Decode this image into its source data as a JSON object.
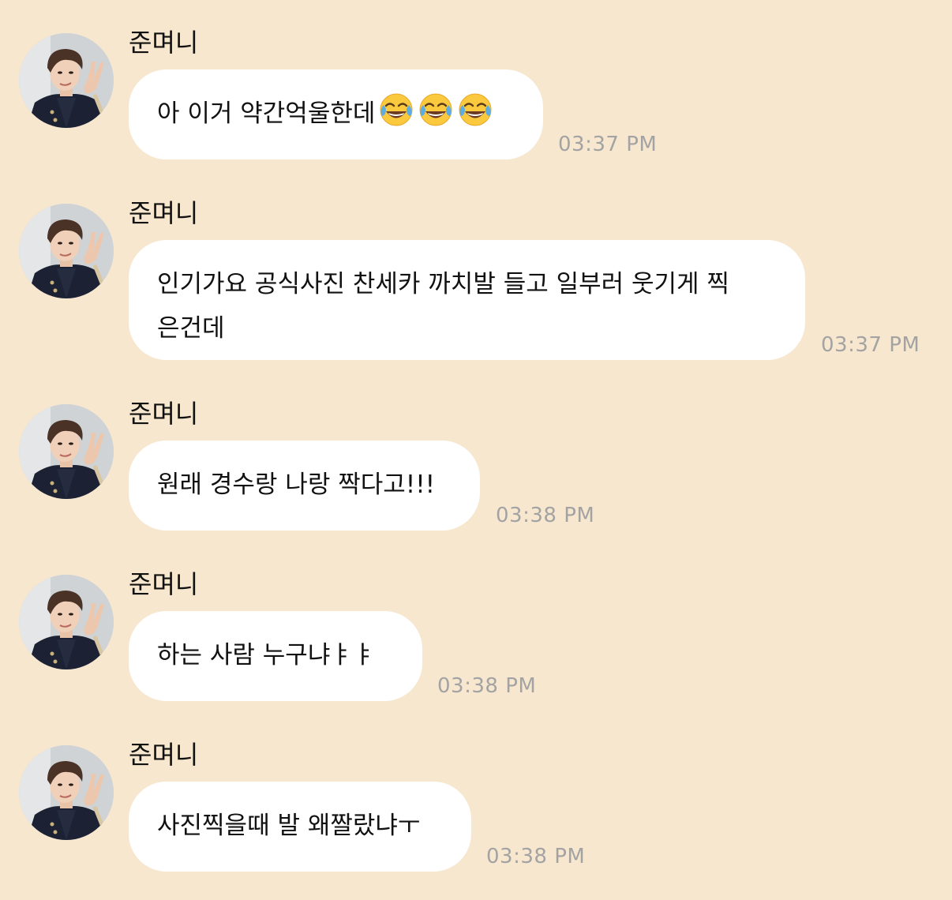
{
  "chat": {
    "messages": [
      {
        "sender": "준며니",
        "text": "아 이거 약간억울한데",
        "emoji": [
          "face-with-tears-of-joy",
          "face-with-tears-of-joy",
          "face-with-tears-of-joy"
        ],
        "time": "03:37 PM"
      },
      {
        "sender": "준며니",
        "text_line1": "인기가요 공식사진 찬세카 까치발 들고 일부러 웃기게 찍",
        "text_line2": "은건데",
        "time": "03:37 PM"
      },
      {
        "sender": "준며니",
        "text": "원래 경수랑 나랑 짝다고!!!",
        "time": "03:38 PM"
      },
      {
        "sender": "준며니",
        "text": "하는 사람 누구냐ㅑㅑ",
        "time": "03:38 PM"
      },
      {
        "sender": "준며니",
        "text": "사진찍을때 발 왜짤랐냐ㅜ",
        "time": "03:38 PM"
      }
    ]
  },
  "colors": {
    "background": "#f7e7cf",
    "bubble": "#ffffff",
    "timestamp": "#a3a3a3"
  }
}
